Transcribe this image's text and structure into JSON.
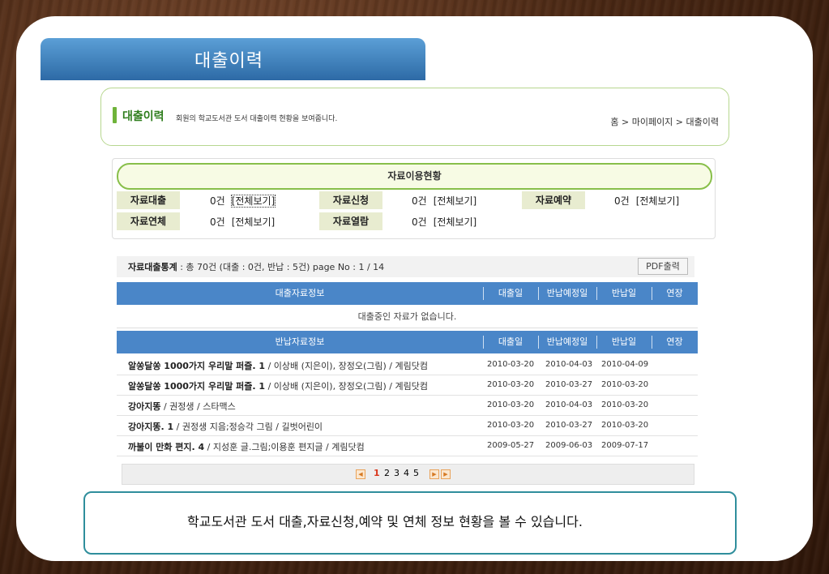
{
  "page_title": "대출이력",
  "header": {
    "title": "대출이력",
    "description": "회원의 학교도서관 도서 대출이력 현황을 보여줍니다.",
    "breadcrumb": "홈 > 마이페이지 > 대출이력"
  },
  "status": {
    "title": "자료이용현황",
    "items": [
      {
        "label": "자료대출",
        "count": "0건",
        "link": "[전체보기]"
      },
      {
        "label": "자료신청",
        "count": "0건",
        "link": "[전체보기]"
      },
      {
        "label": "자료예약",
        "count": "0건",
        "link": "[전체보기]"
      },
      {
        "label": "자료연체",
        "count": "0건",
        "link": "[전체보기]"
      },
      {
        "label": "자료열람",
        "count": "0건",
        "link": "[전체보기]"
      }
    ]
  },
  "stats": {
    "label": "자료대출통계",
    "text": " : 총 70건 (대출 : 0건, 반납 : 5건)   page No : 1 / 14",
    "pdf_button": "PDF출력"
  },
  "loan_table": {
    "headers": [
      "대출자료정보",
      "대출일",
      "반납예정일",
      "반납일",
      "연장"
    ],
    "empty_message": "대출중인 자료가 없습니다."
  },
  "return_table": {
    "headers": [
      "반납자료정보",
      "대출일",
      "반납예정일",
      "반납일",
      "연장"
    ],
    "rows": [
      {
        "title": "알쏭달쏭 1000가지 우리말 퍼즐. 1",
        "meta": " / 이상배 (지은이), 장정오(그림) / 계림닷컴",
        "loan": "2010-03-20",
        "due": "2010-04-03",
        "returned": "2010-04-09"
      },
      {
        "title": "알쏭달쏭 1000가지 우리말 퍼즐. 1",
        "meta": " / 이상배 (지은이), 장정오(그림) / 계림닷컴",
        "loan": "2010-03-20",
        "due": "2010-03-27",
        "returned": "2010-03-20"
      },
      {
        "title": "강아지똥",
        "meta": " / 권정생 / 스타맥스",
        "loan": "2010-03-20",
        "due": "2010-04-03",
        "returned": "2010-03-20"
      },
      {
        "title": "강아지똥. 1",
        "meta": " / 권정생 지음;정승각 그림 / 길벗어린이",
        "loan": "2010-03-20",
        "due": "2010-03-27",
        "returned": "2010-03-20"
      },
      {
        "title": "까불이 만화 편지. 4",
        "meta": " / 지성훈 글.그림;이용훈 편지글 / 계림닷컴",
        "loan": "2009-05-27",
        "due": "2009-06-03",
        "returned": "2009-07-17"
      }
    ]
  },
  "pager": {
    "pages": [
      "1",
      "2",
      "3",
      "4",
      "5"
    ],
    "current": "1"
  },
  "caption": "학교도서관 도서 대출,자료신청,예약 및 연체 정보 현황을 볼 수 있습니다."
}
